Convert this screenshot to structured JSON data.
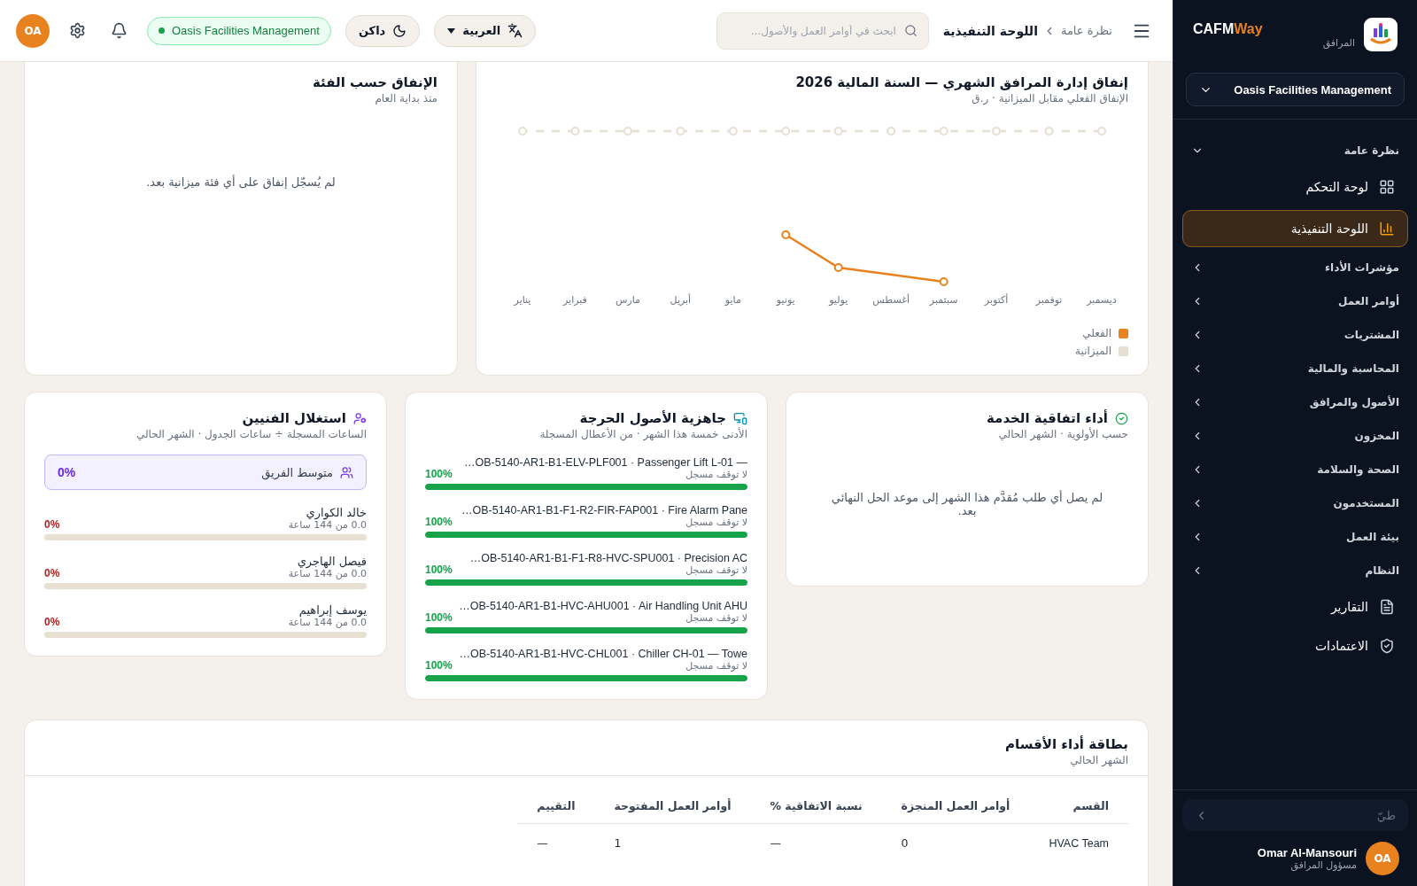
{
  "header": {
    "breadcrumb": [
      "نظرة عامة",
      "اللوحة التنفيذية"
    ],
    "search": {
      "placeholder": "ابحث في أوامر العمل والأصول..."
    },
    "language": {
      "value": "العربية"
    },
    "theme_toggle": {
      "label": "داكن"
    },
    "org_badge": {
      "label": "Oasis Facilities Management",
      "online": true
    },
    "avatar": {
      "initials": "OA"
    }
  },
  "sidebar": {
    "brand": {
      "name": "CAFM",
      "accent": "Way",
      "subtitle": "المرافق"
    },
    "org_select": {
      "value": "Oasis Facilities Management"
    },
    "nav": [
      {
        "kind": "group",
        "label": "نظرة عامة",
        "expanded": true,
        "children": [
          {
            "label": "لوحة التحكم",
            "selected": false
          },
          {
            "label": "اللوحة التنفيذية",
            "selected": true
          }
        ]
      },
      {
        "kind": "group",
        "label": "مؤشرات الأداء",
        "expanded": false
      },
      {
        "kind": "group",
        "label": "أوامر العمل",
        "expanded": false
      },
      {
        "kind": "group",
        "label": "المشتريات",
        "expanded": false
      },
      {
        "kind": "group",
        "label": "المحاسبة والمالية",
        "expanded": false
      },
      {
        "kind": "group",
        "label": "الأصول والمرافق",
        "expanded": false
      },
      {
        "kind": "group",
        "label": "المخزون",
        "expanded": false
      },
      {
        "kind": "group",
        "label": "الصحة والسلامة",
        "expanded": false
      },
      {
        "kind": "group",
        "label": "المستخدمون",
        "expanded": false
      },
      {
        "kind": "group",
        "label": "بيئة العمل",
        "expanded": false
      },
      {
        "kind": "group",
        "label": "النظام",
        "expanded": false
      },
      {
        "kind": "link",
        "label": "التقارير",
        "selected": false
      },
      {
        "kind": "link",
        "label": "الاعتمادات",
        "selected": false
      }
    ],
    "collapse": {
      "label": "طيّ"
    },
    "user": {
      "initials": "OA",
      "name": "Omar Al-Mansouri",
      "role": "مسؤول المرافق"
    }
  },
  "monthly_spend": {
    "title": "إنفاق إدارة المرافق الشهري — السنة المالية 2026",
    "subtitle": "الإنفاق الفعلي مقابل الميزانية · ر.ق",
    "months": [
      "ديسمبر",
      "نوفمبر",
      "أكتوبر",
      "سبتمبر",
      "أغسطس",
      "يوليو",
      "يونيو",
      "مايو",
      "أبريل",
      "مارس",
      "فبراير",
      "يناير"
    ],
    "legend": [
      {
        "label": "الفعلي",
        "color": "#e8821e"
      },
      {
        "label": "الميزانية",
        "color": "#e6e0d4"
      }
    ]
  },
  "spend_by_category": {
    "title": "الإنفاق حسب الفئة",
    "subtitle": "منذ بداية العام",
    "empty": "لم يُسجّل إنفاق على أي فئة ميزانية بعد."
  },
  "sla": {
    "title": "أداء اتفاقية الخدمة",
    "subtitle": "حسب الأولوية · الشهر الحالي",
    "empty": "لم يصل أي طلب مُقدَّم هذا الشهر إلى موعد الحل النهائي بعد."
  },
  "assets": {
    "title": "جاهزية الأصول الحرجة",
    "subtitle": "الأدنى خمسة هذا الشهر · من الأعطال المسجلة",
    "items": [
      {
        "name": "…OB-5140-AR1-B1-ELV-PLF001 · Passenger Lift L-01 —",
        "note": "لا توقف مسجل",
        "percent": "100%",
        "level": 1
      },
      {
        "name": "…OB-5140-AR1-B1-F1-R2-FIR-FAP001 · Fire Alarm Pane",
        "note": "لا توقف مسجل",
        "percent": "100%",
        "level": 1
      },
      {
        "name": "…OB-5140-AR1-B1-F1-R8-HVC-SPU001 · Precision AC",
        "note": "لا توقف مسجل",
        "percent": "100%",
        "level": 1
      },
      {
        "name": "…OB-5140-AR1-B1-HVC-AHU001 · Air Handling Unit AHU",
        "note": "لا توقف مسجل",
        "percent": "100%",
        "level": 1
      },
      {
        "name": "…OB-5140-AR1-B1-HVC-CHL001 · Chiller CH-01 — Towe",
        "note": "لا توقف مسجل",
        "percent": "100%",
        "level": 1
      }
    ]
  },
  "technicians": {
    "title": "استغلال الفنيين",
    "subtitle": "الساعات المسجلة ÷ ساعات الجدول · الشهر الحالي",
    "team_average": {
      "label": "متوسط الفريق",
      "value": "0%"
    },
    "items": [
      {
        "name": "خالد الكواري",
        "hours": "0.0 من 144 ساعة",
        "percent": "0%",
        "level": 0
      },
      {
        "name": "فيصل الهاجري",
        "hours": "0.0 من 144 ساعة",
        "percent": "0%",
        "level": 0
      },
      {
        "name": "يوسف إبراهيم",
        "hours": "0.0 من 144 ساعة",
        "percent": "0%",
        "level": 0
      }
    ]
  },
  "departments": {
    "title": "بطاقة أداء الأقسام",
    "subtitle": "الشهر الحالي",
    "columns": [
      "القسم",
      "أوامر العمل المنجزة",
      "نسبة الاتفاقية %",
      "أوامر العمل المفتوحة",
      "التقييم"
    ],
    "rows": [
      [
        "HVAC Team",
        "0",
        "—",
        "1",
        "—"
      ]
    ]
  }
}
